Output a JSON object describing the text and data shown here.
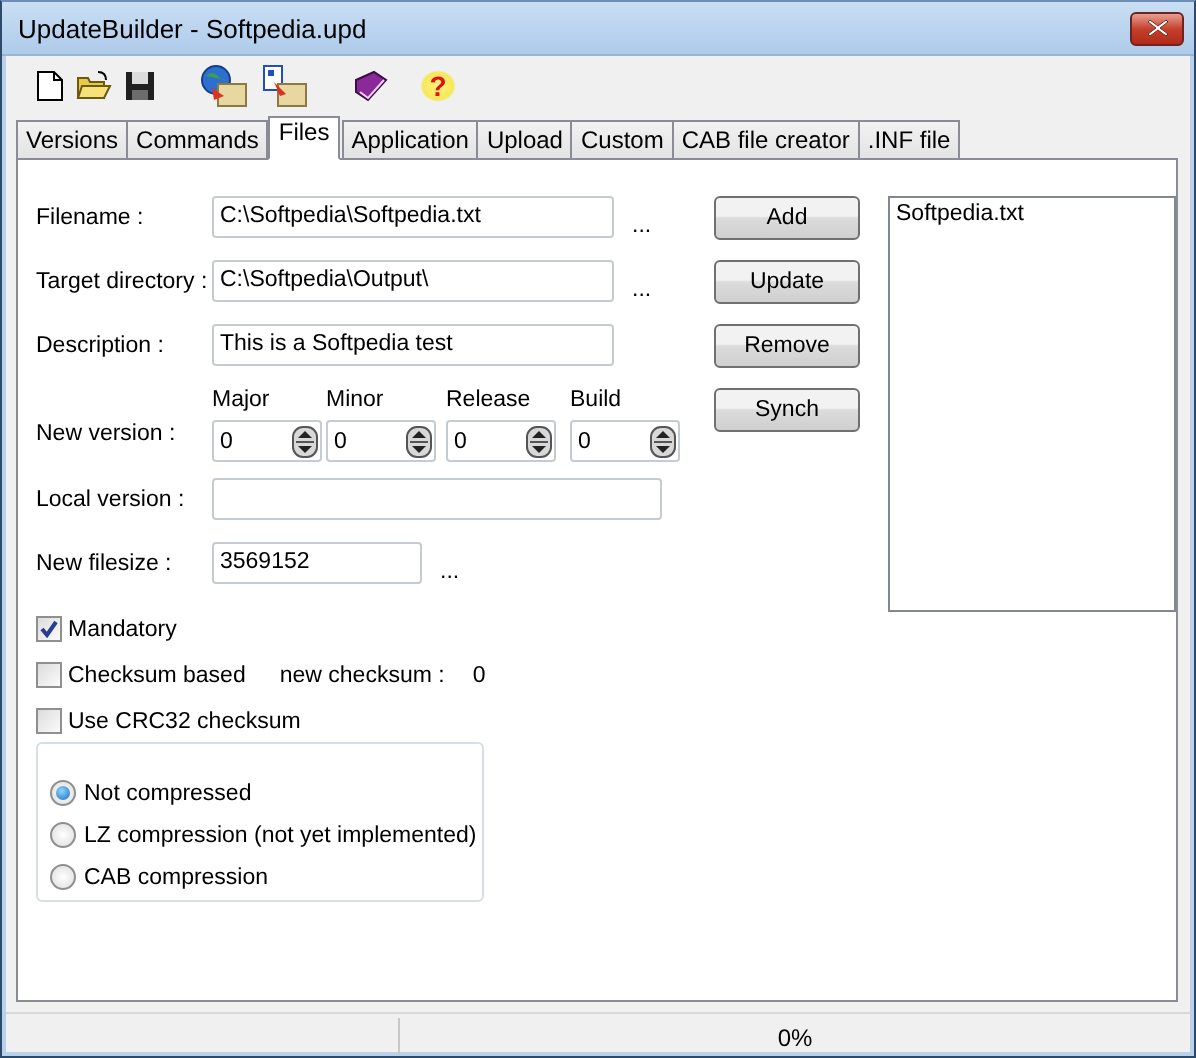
{
  "window": {
    "title": "UpdateBuilder - Softpedia.upd"
  },
  "toolbar": [
    {
      "kind": "new"
    },
    {
      "kind": "open"
    },
    {
      "kind": "save"
    },
    {
      "kind": "web-folder"
    },
    {
      "kind": "file-folder"
    },
    {
      "kind": "book"
    },
    {
      "kind": "help",
      "text": "?"
    }
  ],
  "tabs": [
    {
      "label": "Versions",
      "selected": false
    },
    {
      "label": "Commands",
      "selected": false
    },
    {
      "label": "Files",
      "selected": true
    },
    {
      "label": "Application",
      "selected": false
    },
    {
      "label": "Upload",
      "selected": false
    },
    {
      "label": "Custom",
      "selected": false
    },
    {
      "label": "CAB file creator",
      "selected": false
    },
    {
      "label": ".INF file",
      "selected": false
    }
  ],
  "fields": [
    {
      "kind": "text",
      "label": "Filename :",
      "value": "C:\\Softpedia\\Softpedia.txt",
      "browse": "..."
    },
    {
      "kind": "text",
      "label": "Target directory :",
      "value": "C:\\Softpedia\\Output\\",
      "browse": "..."
    },
    {
      "kind": "text",
      "label": "Description :",
      "value": "This is a Softpedia test"
    },
    {
      "kind": "version",
      "label": "New version :",
      "parts": [
        {
          "label": "Major",
          "value": "0"
        },
        {
          "label": "Minor",
          "value": "0"
        },
        {
          "label": "Release",
          "value": "0"
        },
        {
          "label": "Build",
          "value": "0"
        }
      ]
    },
    {
      "kind": "wide",
      "label": "Local version :"
    },
    {
      "kind": "short",
      "label": "New filesize  :",
      "value": "3569152",
      "browse": "..."
    }
  ],
  "buttons": [
    "Add",
    "Update",
    "Remove",
    "Synch"
  ],
  "file_list": [
    {
      "label": "Softpedia.txt",
      "selected": false
    }
  ],
  "checkboxes": [
    {
      "label": "Mandatory",
      "checked": true
    },
    {
      "label": "Checksum based",
      "checked": false,
      "extra_label": "new checksum :",
      "extra_value": "0"
    },
    {
      "label": "Use CRC32 checksum",
      "checked": false
    }
  ],
  "compression": [
    {
      "label": "Not compressed",
      "selected": true
    },
    {
      "label": "LZ compression (not yet implemented)",
      "selected": false
    },
    {
      "label": "CAB compression",
      "selected": false
    }
  ],
  "status_bar": {
    "progress": "0%"
  }
}
